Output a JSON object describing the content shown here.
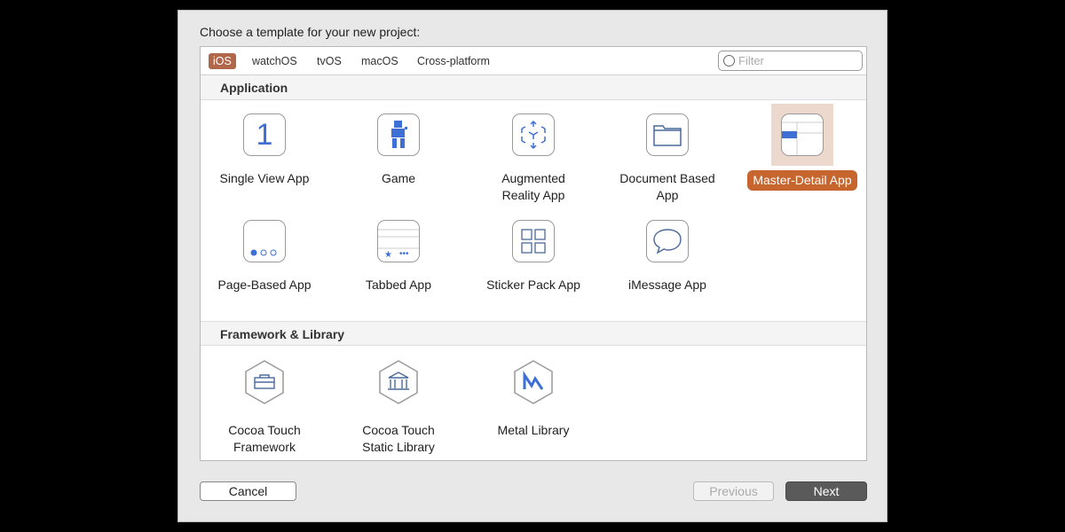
{
  "title": "Choose a template for your new project:",
  "tabs": [
    "iOS",
    "watchOS",
    "tvOS",
    "macOS",
    "Cross-platform"
  ],
  "filter_placeholder": "Filter",
  "sections": [
    {
      "label": "Application",
      "items": [
        "Single View App",
        "Game",
        "Augmented Reality App",
        "Document Based App",
        "Master-Detail App",
        "Page-Based App",
        "Tabbed App",
        "Sticker Pack App",
        "iMessage App"
      ]
    },
    {
      "label": "Framework & Library",
      "items": [
        "Cocoa Touch Framework",
        "Cocoa Touch Static Library",
        "Metal Library"
      ]
    }
  ],
  "selected": "Master-Detail App",
  "buttons": {
    "cancel": "Cancel",
    "previous": "Previous",
    "next": "Next"
  },
  "colors": {
    "selected_tab": "#b0674a",
    "selected_item": "#c7652e",
    "icon_accent": "#3e6fd4"
  }
}
